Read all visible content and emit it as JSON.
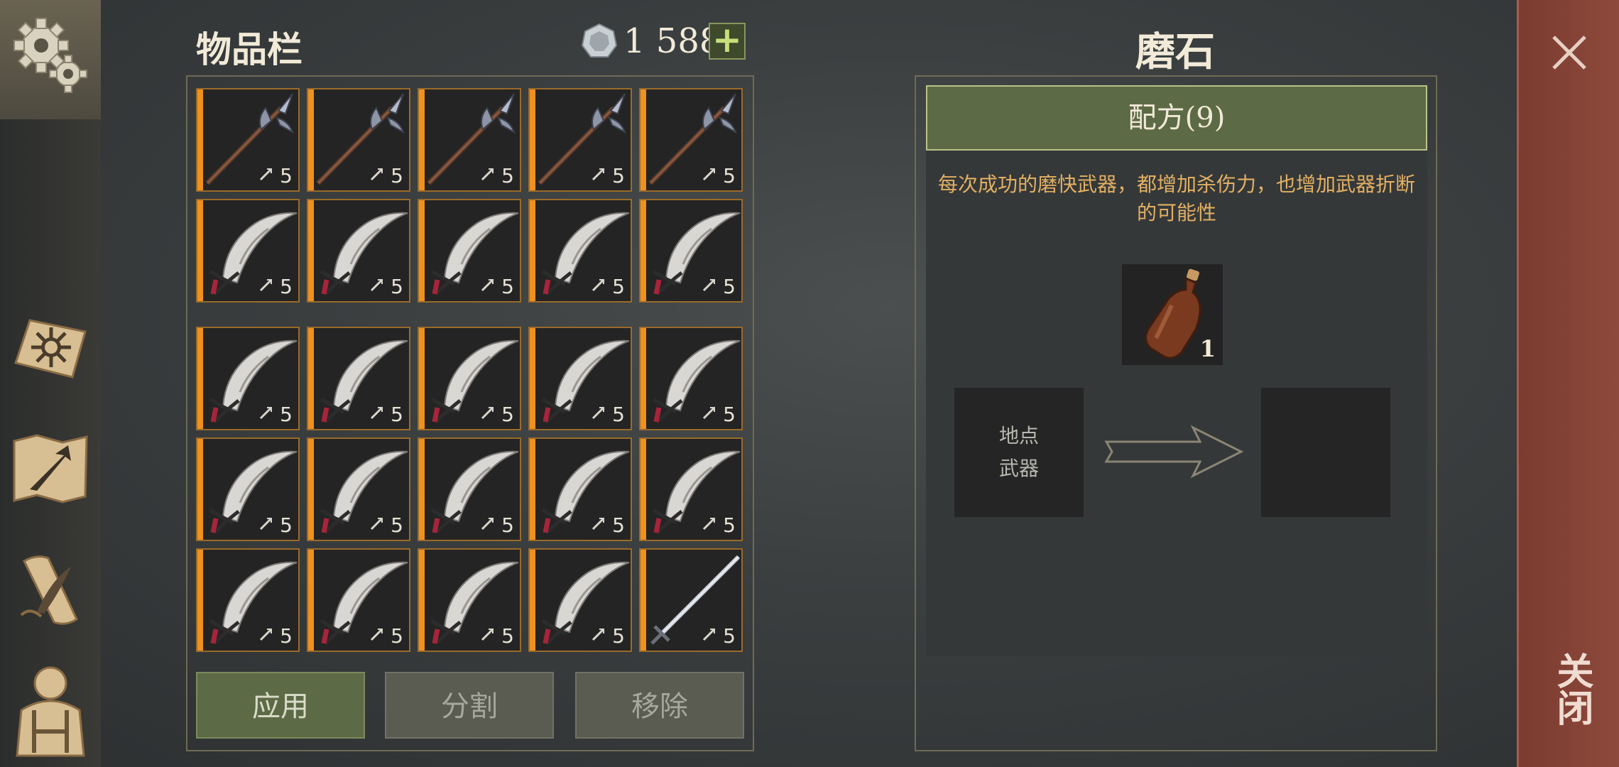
{
  "inventory": {
    "title": "物品栏",
    "currency_value": "1 588",
    "currency_icon": "silver-coin-icon",
    "add_icon": "plus-icon",
    "slots": [
      {
        "item": "halberd",
        "level": "5"
      },
      {
        "item": "halberd",
        "level": "5"
      },
      {
        "item": "halberd",
        "level": "5"
      },
      {
        "item": "halberd",
        "level": "5"
      },
      {
        "item": "halberd",
        "level": "5"
      },
      {
        "item": "scimitar",
        "level": "5"
      },
      {
        "item": "scimitar",
        "level": "5"
      },
      {
        "item": "scimitar",
        "level": "5"
      },
      {
        "item": "scimitar",
        "level": "5"
      },
      {
        "item": "scimitar",
        "level": "5"
      },
      {
        "item": "scimitar",
        "level": "5"
      },
      {
        "item": "scimitar",
        "level": "5"
      },
      {
        "item": "scimitar",
        "level": "5"
      },
      {
        "item": "scimitar",
        "level": "5"
      },
      {
        "item": "scimitar",
        "level": "5"
      },
      {
        "item": "scimitar",
        "level": "5"
      },
      {
        "item": "scimitar",
        "level": "5"
      },
      {
        "item": "scimitar",
        "level": "5"
      },
      {
        "item": "scimitar",
        "level": "5"
      },
      {
        "item": "scimitar",
        "level": "5"
      },
      {
        "item": "scimitar",
        "level": "5"
      },
      {
        "item": "scimitar",
        "level": "5"
      },
      {
        "item": "scimitar",
        "level": "5"
      },
      {
        "item": "scimitar",
        "level": "5"
      },
      {
        "item": "sword",
        "level": "5"
      }
    ]
  },
  "actions": {
    "apply": "应用",
    "split": "分割",
    "remove": "移除"
  },
  "crafting": {
    "title": "磨石",
    "recipe_label": "配方(9)",
    "description": "每次成功的磨快武器，都增加杀伤力，也增加武器折断的可能性",
    "ingredient_icon": "bottle-icon",
    "ingredient_count": "1",
    "input_slot_line1": "地点",
    "input_slot_line2": "武器"
  },
  "close": {
    "label": "关闭",
    "icon": "close-icon"
  },
  "sidebar": {
    "items": [
      "gear-icon",
      "sun-book-icon",
      "map-arrow-icon",
      "scroll-quill-icon",
      "character-icon"
    ]
  },
  "colors": {
    "slot_accent": "#f0901f",
    "apply_button": "#5d6a46",
    "description_text": "#e2b063",
    "close_strip": "#8d4a3c"
  }
}
